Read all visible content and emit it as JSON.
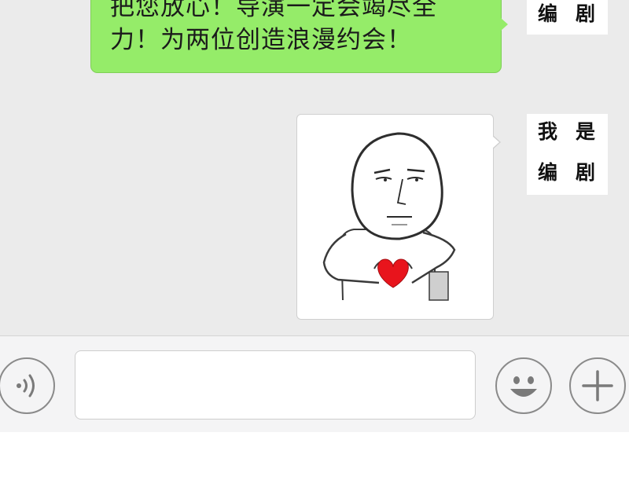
{
  "chat": {
    "outgoing_text": {
      "line1": "把您放心！导演一定会竭尽全",
      "line2": "力！为两位创造浪漫约会！"
    },
    "avatar_label": {
      "line1": [
        "我",
        "是"
      ],
      "line2": [
        "编",
        "剧"
      ]
    },
    "sticker": "heart-hands-meme-sticker"
  },
  "input_bar": {
    "message_value": "",
    "voice_icon": "voice-icon",
    "emoji_icon": "smiley-emoji-icon",
    "plus_icon": "plus-icon"
  },
  "colors": {
    "chat_background": "#ebebeb",
    "outgoing_bubble": "#95ec69",
    "input_bar_background": "#f4f4f5",
    "heart": "#e8141c"
  }
}
